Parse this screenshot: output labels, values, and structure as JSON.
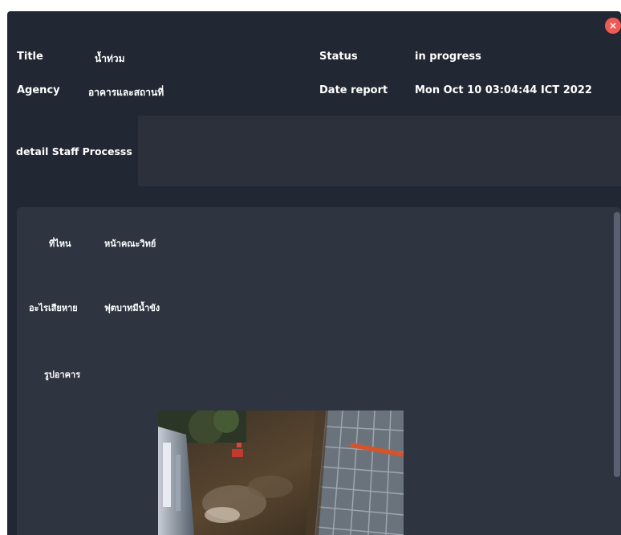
{
  "header": {
    "title_label": "Title",
    "title_value": "น้ำท่วม",
    "status_label": "Status",
    "status_value": "in progress",
    "agency_label": "Agency",
    "agency_value": "อาคารและสถานที่",
    "date_label": "Date report",
    "date_value": "Mon Oct 10 03:04:44 ICT 2022"
  },
  "detail": {
    "label": "detail Staff Processs",
    "value": ""
  },
  "fields": {
    "where_label": "ที่ไหน",
    "where_value": "หน้าคณะวิทย์",
    "damage_label": "อะไรเสียหาย",
    "damage_value": "ฟุตบาทมีน้ำขัง",
    "photo_label": "รูปอาคาร"
  },
  "close_icon": "close-icon",
  "colors": {
    "background": "#222833",
    "panel": "#2e3440",
    "close": "#f05a55"
  }
}
